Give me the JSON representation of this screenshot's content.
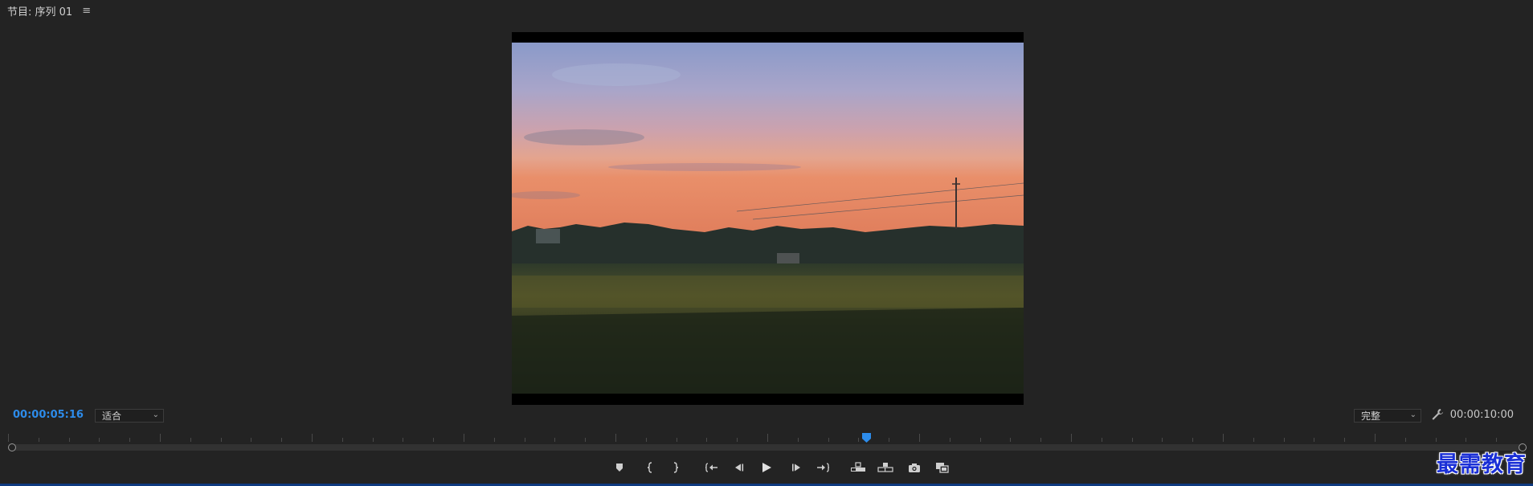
{
  "panel": {
    "title": "节目: 序列 01",
    "menu_icon": "≡"
  },
  "monitor": {
    "current_timecode": "00:00:05:16",
    "zoom_value": "适合",
    "quality_value": "完整",
    "total_duration": "00:00:10:00",
    "playhead_fraction": 0.566
  },
  "transport": {
    "buttons": [
      {
        "name": "add-marker-icon"
      },
      {
        "name": "mark-in-icon"
      },
      {
        "name": "mark-out-icon"
      },
      {
        "name": "go-to-in-icon"
      },
      {
        "name": "step-back-icon"
      },
      {
        "name": "play-icon"
      },
      {
        "name": "step-forward-icon"
      },
      {
        "name": "go-to-out-icon"
      },
      {
        "name": "lift-icon"
      },
      {
        "name": "extract-icon"
      },
      {
        "name": "export-frame-icon"
      },
      {
        "name": "comparison-view-icon"
      }
    ]
  },
  "colors": {
    "accent": "#2d8ceb",
    "background": "#232323"
  },
  "watermark": "最需教育"
}
